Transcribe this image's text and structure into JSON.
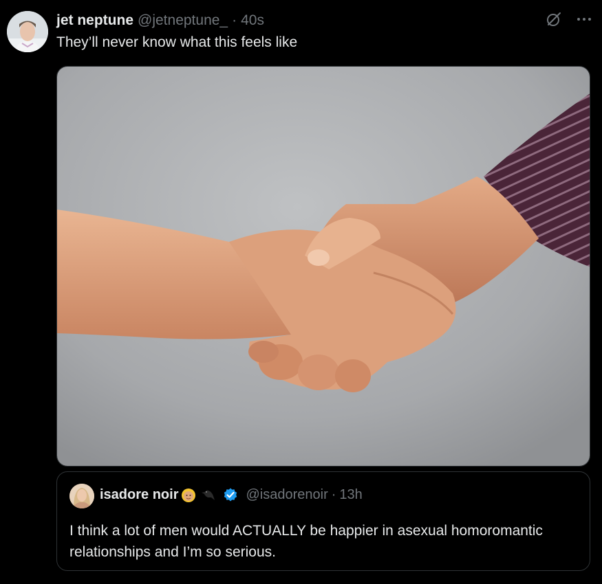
{
  "post": {
    "author": {
      "display_name": "jet neptune",
      "handle": "@jetneptune_",
      "separator": "·",
      "time": "40s"
    },
    "text": "They’ll never know what this feels like",
    "icons": {
      "grok": "grok-icon",
      "more": "more-options-icon"
    },
    "media": {
      "type": "photo",
      "subject": "handshake",
      "background_color": "#a9abae"
    }
  },
  "quote": {
    "author": {
      "display_name": "isadore noir",
      "emoji_1": "woman-blond-hair-emoji",
      "emoji_2": "crow-emoji",
      "verified": true,
      "handle": "@isadorenoir",
      "separator": "·",
      "time": "13h"
    },
    "text": "I think a lot of men would ACTUALLY be happier in asexual homoromantic relationships and I’m so serious."
  },
  "colors": {
    "background": "#000000",
    "text_primary": "#e7e9ea",
    "text_secondary": "#71767b",
    "border": "#2f3336",
    "verified_blue": "#1d9bf0"
  }
}
